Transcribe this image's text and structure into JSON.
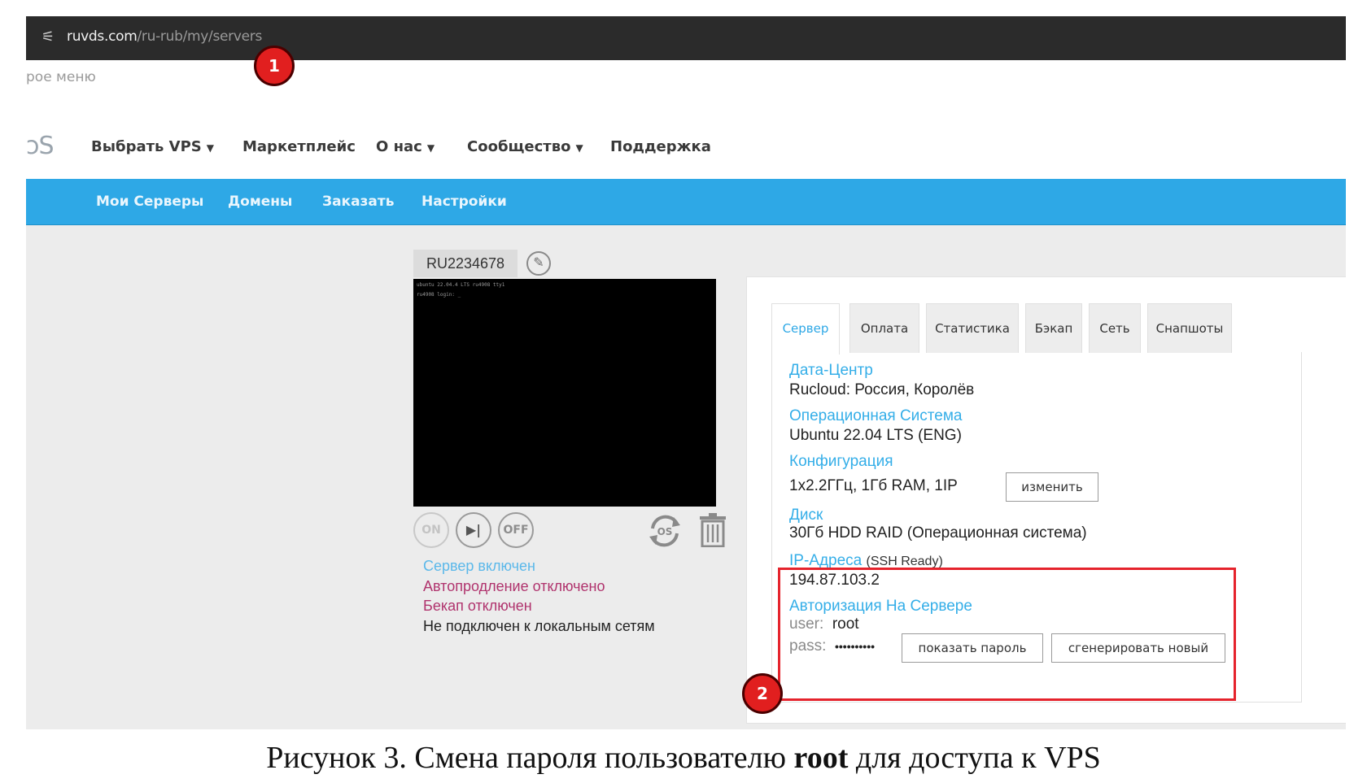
{
  "browser": {
    "url_host": "ruvds.com",
    "url_path": "/ru-rub/my/servers",
    "site_icon": "tune-icon"
  },
  "quick_menu": {
    "label": "рое меню"
  },
  "logo_fragment": "ɔS",
  "main_nav": [
    {
      "label": "Выбрать VPS",
      "dropdown": true
    },
    {
      "label": "Маркетплейс",
      "dropdown": false
    },
    {
      "label": "О нас",
      "dropdown": true
    },
    {
      "label": "Сообщество",
      "dropdown": true
    },
    {
      "label": "Поддержка",
      "dropdown": false
    }
  ],
  "sub_nav": [
    "Мои Серверы",
    "Домены",
    "Заказать",
    "Настройки"
  ],
  "server": {
    "id": "RU2234678",
    "console_lines": [
      "ubuntu 22.04.4 LTS ru4908 tty1",
      "ru4908 login: _"
    ],
    "controls": {
      "on": "ON",
      "off": "OFF",
      "reinstall": "OS"
    },
    "status": {
      "power": "Сервер включен",
      "autorenew": "Автопродление отключено",
      "backup": "Бекап отключен",
      "lan": "Не подключен к локальным сетям"
    }
  },
  "tabs": [
    "Сервер",
    "Оплата",
    "Статистика",
    "Бэкап",
    "Сеть",
    "Снапшоты"
  ],
  "details": {
    "datacenter_label": "Дата-Центр",
    "datacenter_value": "Rucloud: Россия, Королёв",
    "os_label": "Операционная Система",
    "os_value": "Ubuntu 22.04 LTS (ENG)",
    "config_label": "Конфигурация",
    "config_value": "1x2.2ГГц, 1Гб RAM, 1IP",
    "config_change_button": "изменить",
    "disk_label": "Диск",
    "disk_value": "30Гб HDD RAID (Операционная система)",
    "ip_label": "IP-Адреса",
    "ip_note": "(SSH Ready)",
    "ip_value": "194.87.103.2",
    "auth_label": "Авторизация На Сервере",
    "user_label": "user:",
    "user_value": "root",
    "pass_label": "pass:",
    "pass_value": "••••••••••",
    "show_password_button": "показать пароль",
    "generate_button": "сгенерировать новый"
  },
  "markers": [
    "1",
    "2"
  ],
  "caption": {
    "prefix": "Рисунок 3. Смена пароля пользователю ",
    "bold": "root",
    "suffix": " для доступа к VPS"
  },
  "colors": {
    "accent_blue": "#2ea8e6",
    "marker_red": "#e11f1f",
    "status_red": "#b0336d"
  }
}
